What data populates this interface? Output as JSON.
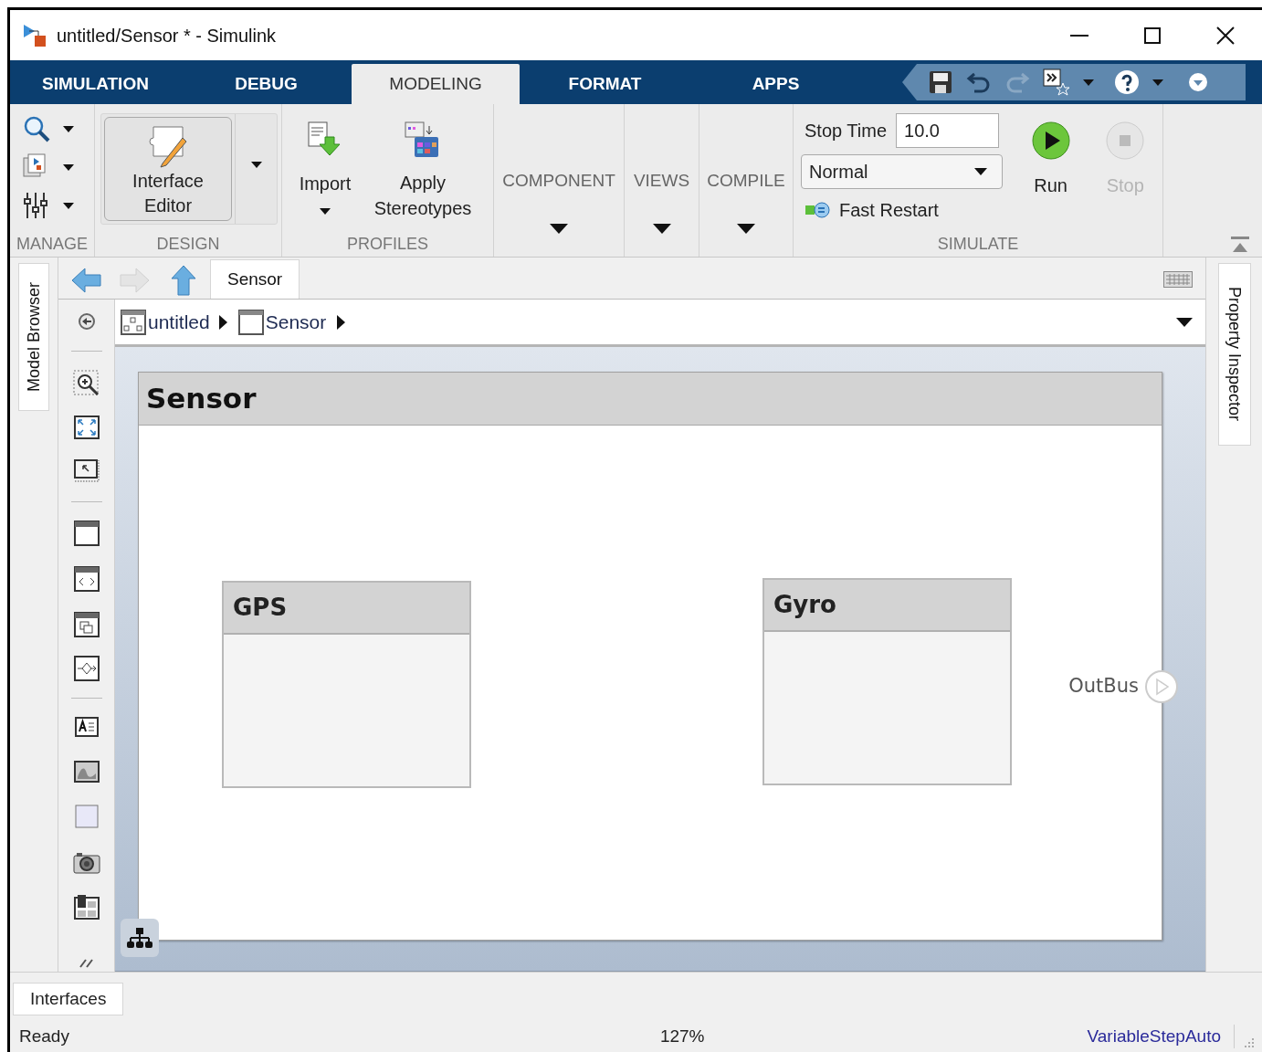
{
  "window": {
    "title": "untitled/Sensor * - Simulink"
  },
  "tabs": [
    {
      "label": "SIMULATION",
      "selected": false
    },
    {
      "label": "DEBUG",
      "selected": false
    },
    {
      "label": "MODELING",
      "selected": true
    },
    {
      "label": "FORMAT",
      "selected": false
    },
    {
      "label": "APPS",
      "selected": false
    }
  ],
  "ribbon": {
    "sections": [
      {
        "kind": "manage",
        "label": "MANAGE"
      },
      {
        "kind": "design",
        "label": "DESIGN",
        "button": "Interface Editor"
      },
      {
        "kind": "profiles",
        "label": "PROFILES",
        "buttons": [
          "Import",
          "Apply Stereotypes"
        ]
      },
      {
        "kind": "gallery",
        "label": "COMPONENT"
      },
      {
        "kind": "gallery",
        "label": "VIEWS"
      },
      {
        "kind": "gallery",
        "label": "COMPILE"
      },
      {
        "kind": "simulate",
        "label": "SIMULATE",
        "stop_time_label": "Stop Time",
        "stop_time": "10.0",
        "mode": "Normal",
        "fast_restart": "Fast Restart",
        "run": {
          "label": "Run",
          "disabled": false
        },
        "stop": {
          "label": "Stop",
          "disabled": true
        }
      }
    ]
  },
  "model_browser": {
    "label": "Model Browser"
  },
  "property_inspector": {
    "label": "Property Inspector"
  },
  "editor": {
    "tab": "Sensor",
    "breadcrumb": [
      "untitled",
      "Sensor"
    ],
    "component": {
      "title": "Sensor",
      "blocks": [
        {
          "name": "GPS"
        },
        {
          "name": "Gyro"
        }
      ],
      "ports": [
        {
          "name": "OutBus"
        }
      ]
    }
  },
  "bottom_tabs": [
    {
      "label": "Interfaces"
    }
  ],
  "status_bar": {
    "state": "Ready",
    "zoom": "127%",
    "solver": "VariableStepAuto"
  }
}
